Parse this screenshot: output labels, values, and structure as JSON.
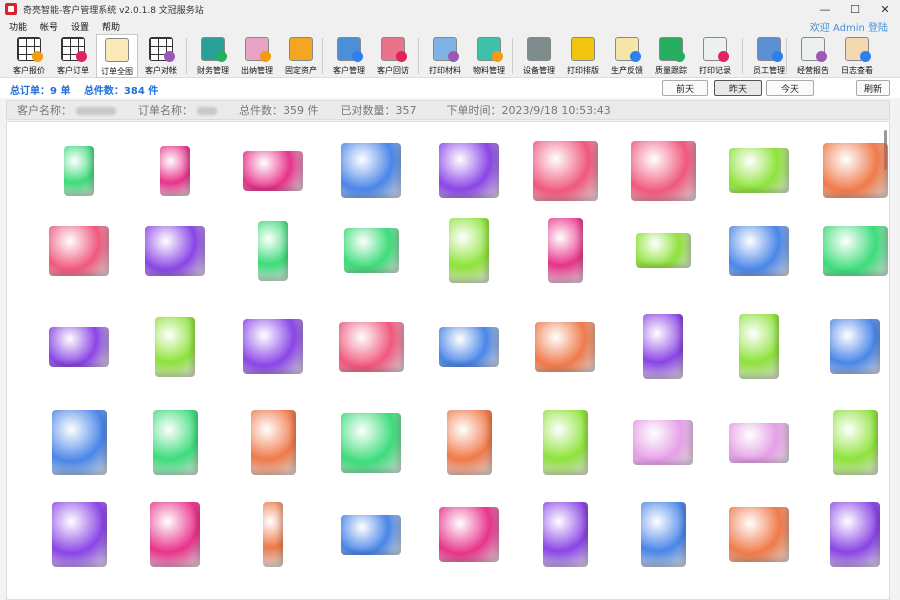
{
  "window": {
    "title": "奇亮智能-客户管理系统 v2.0.1.8 文冠服务站",
    "controls": [
      "—",
      "☐",
      "✕"
    ]
  },
  "menu": {
    "items": [
      "功能",
      "帐号",
      "设置",
      "帮助"
    ],
    "welcome": "欢迎 Admin 登陆"
  },
  "toolbar": {
    "groups": [
      [
        {
          "label": "客户报价",
          "icon": "grid-icon",
          "badge": "orange"
        },
        {
          "label": "客户订单",
          "icon": "grid-icon",
          "badge": "red"
        },
        {
          "label": "订单全图",
          "icon": "picture-icon",
          "badge": "none",
          "active": true
        },
        {
          "label": "客户对帐",
          "icon": "grid-icon",
          "badge": "purple"
        }
      ],
      [
        {
          "label": "财务管理",
          "icon": "finance-icon",
          "badge": "green"
        },
        {
          "label": "出纳管理",
          "icon": "hand-icon",
          "badge": "orange"
        },
        {
          "label": "固定资产",
          "icon": "monitor-icon",
          "badge": "none"
        }
      ],
      [
        {
          "label": "客户管理",
          "icon": "people-icon",
          "badge": "blue"
        },
        {
          "label": "客户回访",
          "icon": "people-call-icon",
          "badge": "red"
        }
      ],
      [
        {
          "label": "打印材料",
          "icon": "flask-icon",
          "badge": "purple"
        },
        {
          "label": "物料管理",
          "icon": "glove-icon",
          "badge": "orange"
        }
      ],
      [
        {
          "label": "设备管理",
          "icon": "printer-icon",
          "badge": "none"
        },
        {
          "label": "打印排版",
          "icon": "layout-icon",
          "badge": "none"
        },
        {
          "label": "生产反馈",
          "icon": "feedback-icon",
          "badge": "blue"
        },
        {
          "label": "质量跟踪",
          "icon": "quality-icon",
          "badge": "green"
        },
        {
          "label": "打印记录",
          "icon": "record-icon",
          "badge": "red"
        }
      ],
      [
        {
          "label": "员工管理",
          "icon": "staff-icon",
          "badge": "blue"
        }
      ],
      [
        {
          "label": "经营报告",
          "icon": "report-icon",
          "badge": "purple"
        },
        {
          "label": "日志查看",
          "icon": "log-icon",
          "badge": "blue"
        }
      ]
    ]
  },
  "summary": {
    "total_orders": "总订单：9 单",
    "total_parts": "总件数：384 件",
    "buttons": {
      "prev_day": "前天",
      "yesterday": "昨天",
      "today": "今天",
      "refresh": "刷新"
    }
  },
  "order_info": {
    "customer_label": "客户名称：",
    "order_label": "订单名称：",
    "total_count": "总件数：359 件",
    "checked_count": "已对数量：357",
    "order_time": "下单时间：2023/9/18 10:53:43"
  },
  "parts": {
    "colors": {
      "green": "#3ddc7a",
      "magenta": "#e8338a",
      "blue": "#4a86e8",
      "purple": "#8a45e6",
      "pink": "#f0587d",
      "lime": "#8fe33c",
      "orange": "#f07a4a",
      "lavender": "#e6a0e8"
    },
    "rows": [
      [
        "green",
        "magenta",
        "magenta",
        "blue",
        "purple",
        "pink",
        "pink",
        "lime",
        "orange"
      ],
      [
        "pink",
        "purple",
        "green",
        "green",
        "lime",
        "magenta",
        "lime",
        "blue",
        "green"
      ],
      [
        "purple",
        "lime",
        "purple",
        "pink",
        "blue",
        "orange",
        "purple",
        "lime",
        "blue"
      ],
      [
        "blue",
        "green",
        "orange",
        "green",
        "orange",
        "lime",
        "lavender",
        "lavender",
        "lime"
      ],
      [
        "purple",
        "magenta",
        "orange",
        "blue",
        "magenta",
        "purple",
        "blue",
        "orange",
        "purple"
      ]
    ]
  }
}
